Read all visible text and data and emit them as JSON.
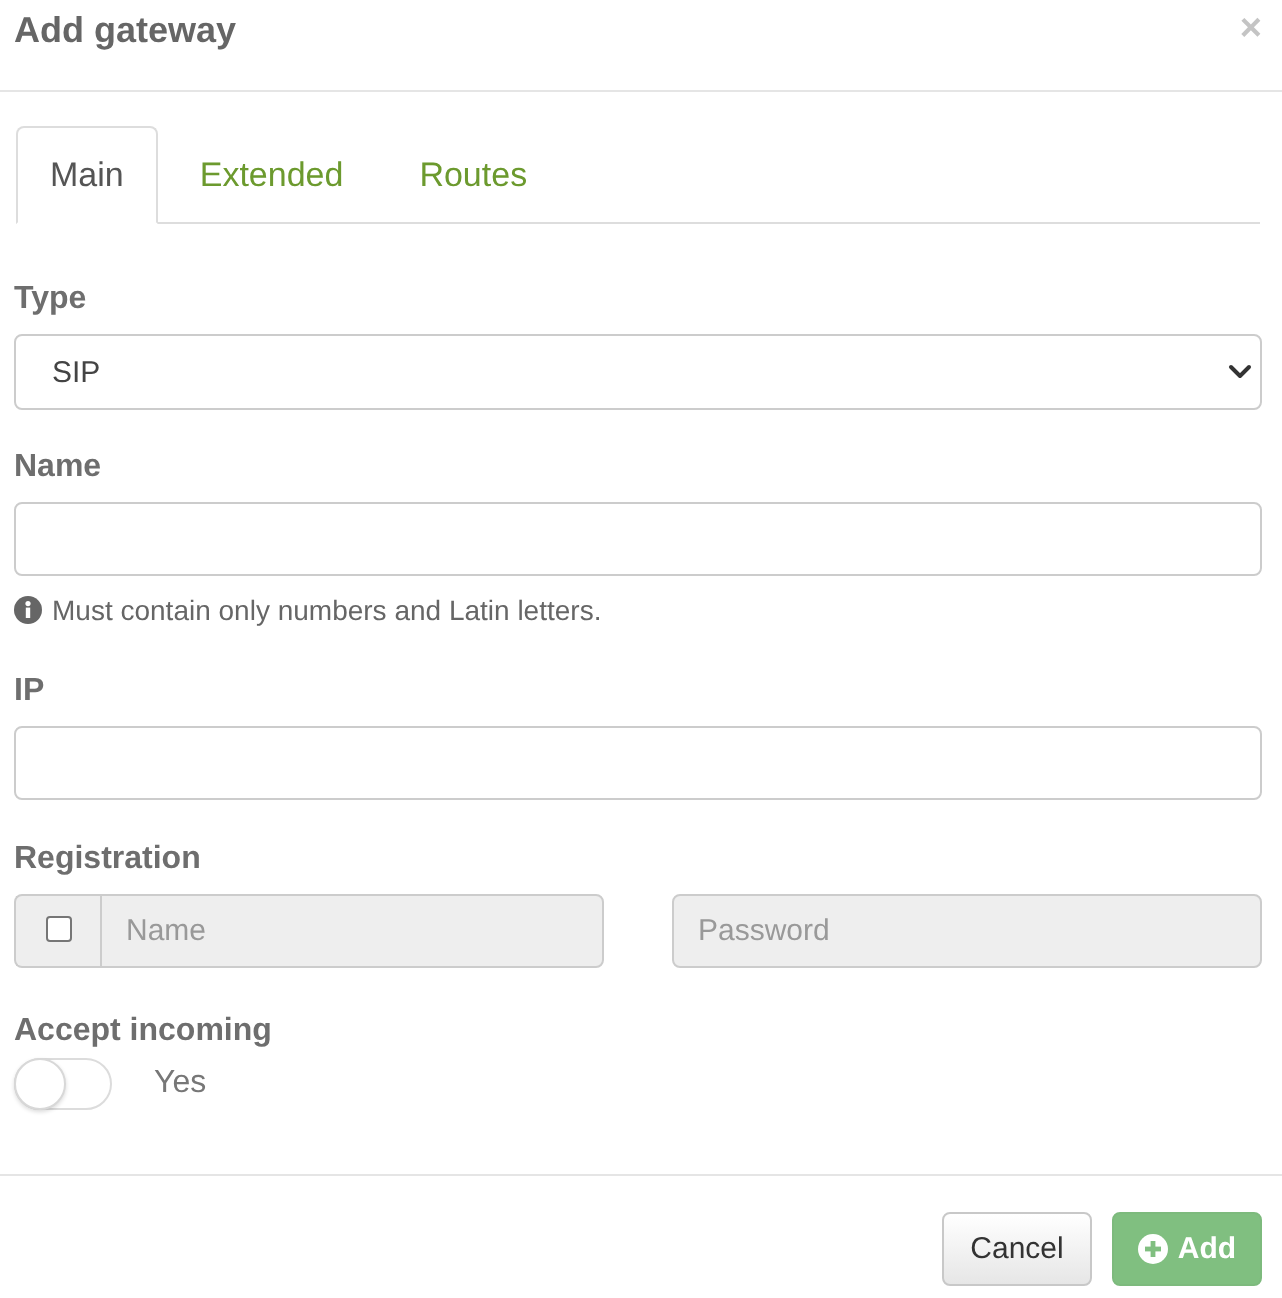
{
  "dialog": {
    "title": "Add gateway",
    "close": "×"
  },
  "tabs": [
    {
      "label": "Main",
      "selected": true
    },
    {
      "label": "Extended",
      "selected": false
    },
    {
      "label": "Routes",
      "selected": false
    }
  ],
  "type": {
    "label": "Type",
    "value": "SIP"
  },
  "name": {
    "label": "Name",
    "hint": "Must contain only numbers and Latin letters."
  },
  "ip": {
    "label": "IP"
  },
  "registration": {
    "label": "Registration",
    "checked": false,
    "name": {
      "placeholder": "Name",
      "disabled": true
    },
    "password": {
      "placeholder": "Password",
      "disabled": true
    }
  },
  "accept_incoming": {
    "label": "Accept incoming",
    "on": false,
    "text": "Yes"
  },
  "buttons": [
    {
      "kind": "cancel",
      "label": "Cancel"
    },
    {
      "kind": "primary",
      "label": "Add"
    }
  ]
}
